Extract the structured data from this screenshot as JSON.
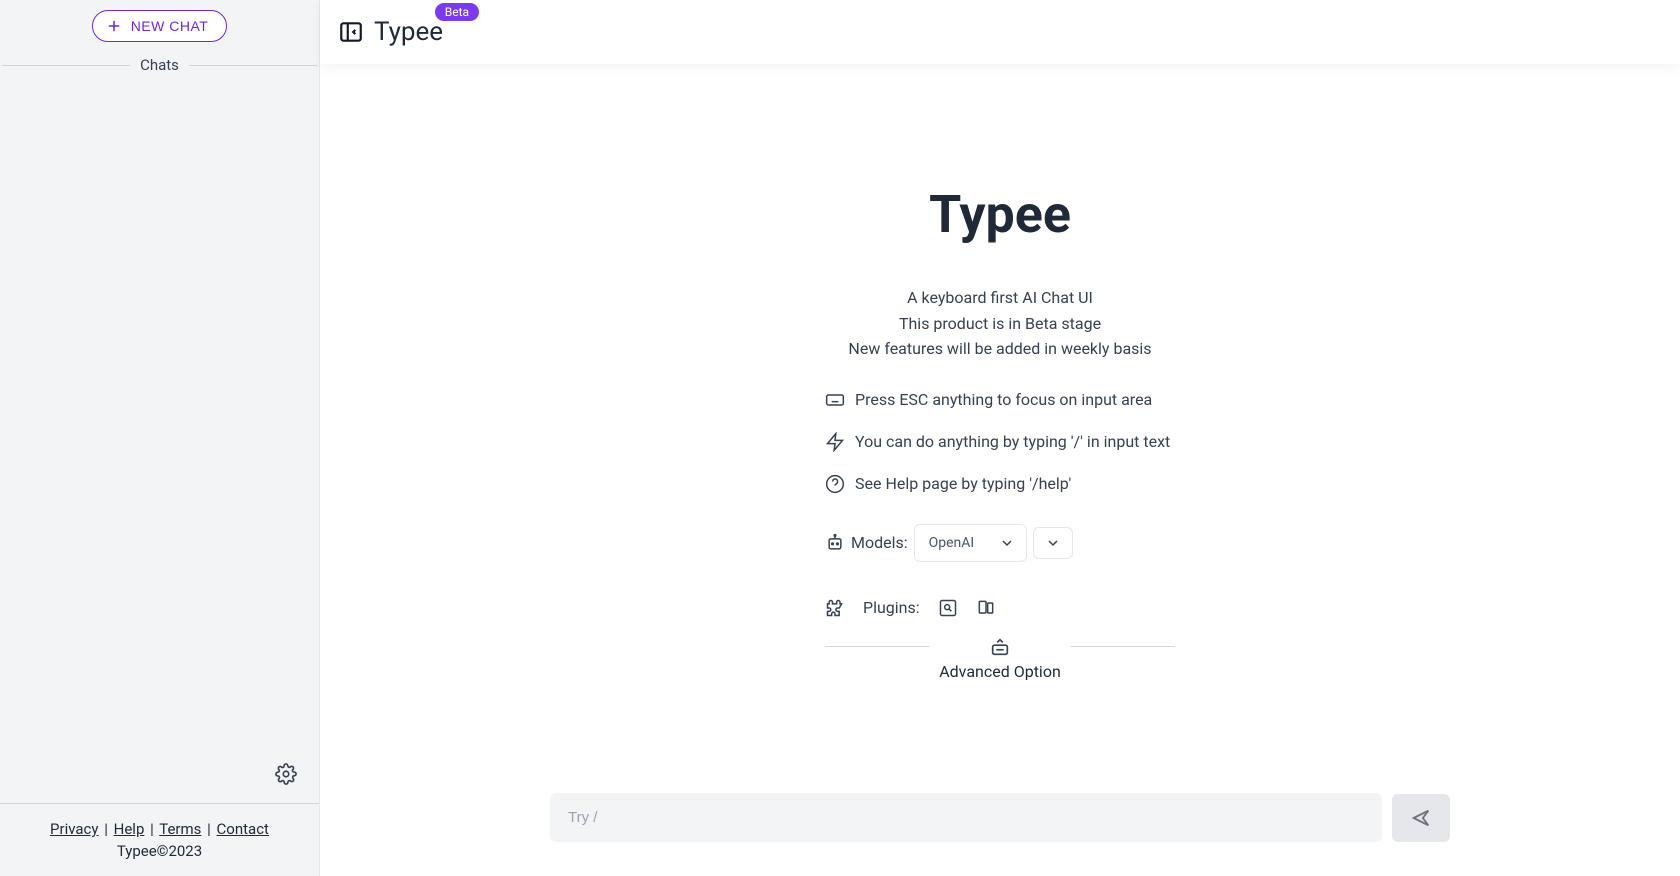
{
  "sidebar": {
    "new_chat_label": "NEW CHAT",
    "section_label": "Chats"
  },
  "footer": {
    "privacy": "Privacy",
    "help": "Help",
    "terms": "Terms",
    "contact": "Contact",
    "copyright": "Typee©2023"
  },
  "header": {
    "brand": "Typee",
    "badge": "Beta"
  },
  "hero": {
    "title": "Typee",
    "subtitle_1": "A keyboard first AI Chat UI",
    "subtitle_2": "This product is in Beta stage",
    "subtitle_3": "New features will be added in weekly basis"
  },
  "tips": {
    "esc": "Press ESC anything to focus on input area",
    "slash": "You can do anything by typing '/' in input text",
    "help": "See Help page by typing '/help'"
  },
  "models": {
    "label": "Models:",
    "selected": "OpenAI"
  },
  "plugins": {
    "label": "Plugins:"
  },
  "advanced": {
    "label": "Advanced Option"
  },
  "input": {
    "placeholder": "Try /"
  }
}
